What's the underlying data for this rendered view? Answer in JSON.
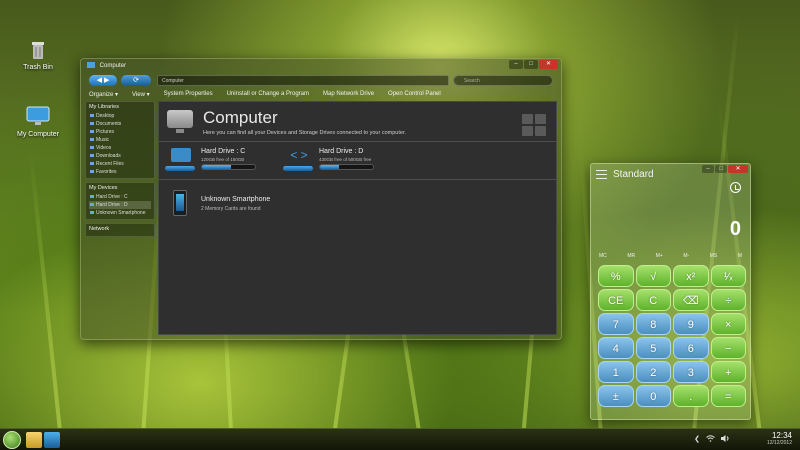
{
  "desktop": {
    "icons": [
      {
        "label": "Trash Bin"
      },
      {
        "label": "My Computer"
      }
    ]
  },
  "explorer": {
    "title": "Computer",
    "nav": {
      "back": "◀",
      "forward": "▶"
    },
    "address": "Computer",
    "search_placeholder": "Search",
    "toolbar": [
      "Organize ▾",
      "View ▾",
      "System Properties",
      "Uninstall or Change a Program",
      "Map Network Drive",
      "Open Control Panel"
    ],
    "sidebar": {
      "libraries_header": "My Libraries",
      "libraries": [
        "Desktop",
        "Documents",
        "Pictures",
        "Music",
        "Videos",
        "Downloads",
        "Recent Files",
        "Favorites"
      ],
      "devices_header": "My Devices",
      "devices": [
        "Hard Drive : C",
        "Hard Drive : D",
        "Unknown Smartphone"
      ],
      "network_header": "Network"
    },
    "heading": "Computer",
    "subheading": "Here you can find all your Devices and Storage Drives connected to your computer.",
    "drives": [
      {
        "name": "Hard Drive : C",
        "free": "120GB free of 150GB",
        "used_fraction": 0.55
      },
      {
        "name": "Hard Drive : D",
        "free": "430GB free of 500GB free",
        "used_fraction": 0.35
      }
    ],
    "device": {
      "name": "Unknown Smartphone",
      "info": "2 Memory Cards are found"
    }
  },
  "calculator": {
    "mode": "Standard",
    "display": "0",
    "memory": [
      "MC",
      "MR",
      "M+",
      "M-",
      "MS",
      "M"
    ],
    "keys": [
      "%",
      "√",
      "x²",
      "¹⁄ₓ",
      "CE",
      "C",
      "⌫",
      "÷",
      "7",
      "8",
      "9",
      "×",
      "4",
      "5",
      "6",
      "−",
      "1",
      "2",
      "3",
      "+",
      "±",
      "0",
      ".",
      "="
    ]
  },
  "taskbar": {
    "tray": [
      "❮",
      "wifi",
      "🔊"
    ],
    "time": "12:34",
    "date": "12/12/2012"
  },
  "colors": {
    "accent_blue": "#3a8cc8",
    "calc_green": "#7cc444",
    "calc_blue": "#6aaad6",
    "close_red": "#c5362a"
  }
}
